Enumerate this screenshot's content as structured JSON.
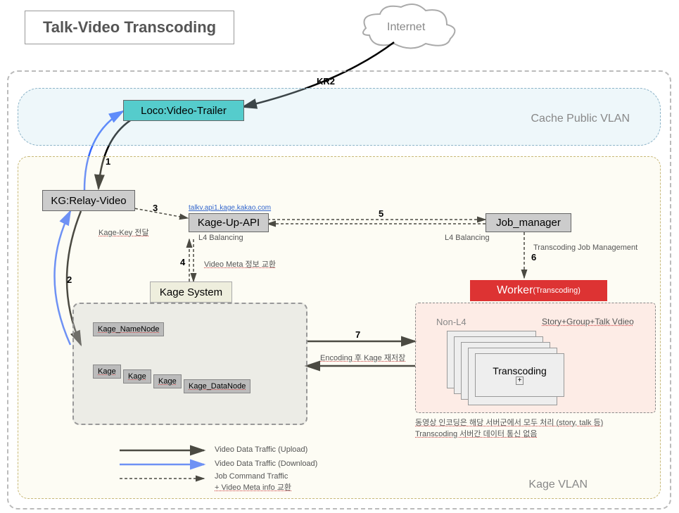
{
  "title": "Talk-Video Transcoding",
  "cloud": "Internet",
  "kr2_label": "KR2",
  "cache_vlan_label": "Cache Public VLAN",
  "kage_vlan_label": "Kage   VLAN",
  "boxes": {
    "loco": "Loco:Video-Trailer",
    "kg_relay": "KG:Relay-Video",
    "kage_up_api": "Kage-Up-API",
    "kage_up_url": "talkv.api1.kage.kakao.com",
    "job_manager": "Job_manager",
    "worker": "Worker",
    "worker_sub": "(Transcoding)",
    "kage_system": "Kage System",
    "namenode": "Kage_NameNode",
    "datanode_prefix": "Kage",
    "datanode_full": "Kage_DataNode",
    "transcoding": "Transcoding"
  },
  "annotations": {
    "l4_balancing": "L4 Balancing",
    "non_l4": "Non-L4",
    "transcoding_job_mgmt": "Transcoding Job Management",
    "kage_key": "Kage-Key 전달",
    "video_meta": "Video Meta 정보 교환",
    "encoding_restore": "Encoding 후 Kage 재저장",
    "story_group": "Story+Group+Talk Vdieo",
    "footer1": "동영상 인코딩은 해당 서버군에서 모두 처리 (story, talk 등)",
    "footer2": "Transcoding 서버간 데이터 통신 없음"
  },
  "nums": {
    "n1": "1",
    "n2": "2",
    "n3": "3",
    "n4": "4",
    "n5": "5",
    "n6": "6",
    "n7": "7"
  },
  "legend": {
    "upload": "Video Data Traffic (Upload)",
    "download": "Video Data Traffic (Download)",
    "job": "Job Command Traffic",
    "job2": "+ Video Meta info 교환"
  }
}
